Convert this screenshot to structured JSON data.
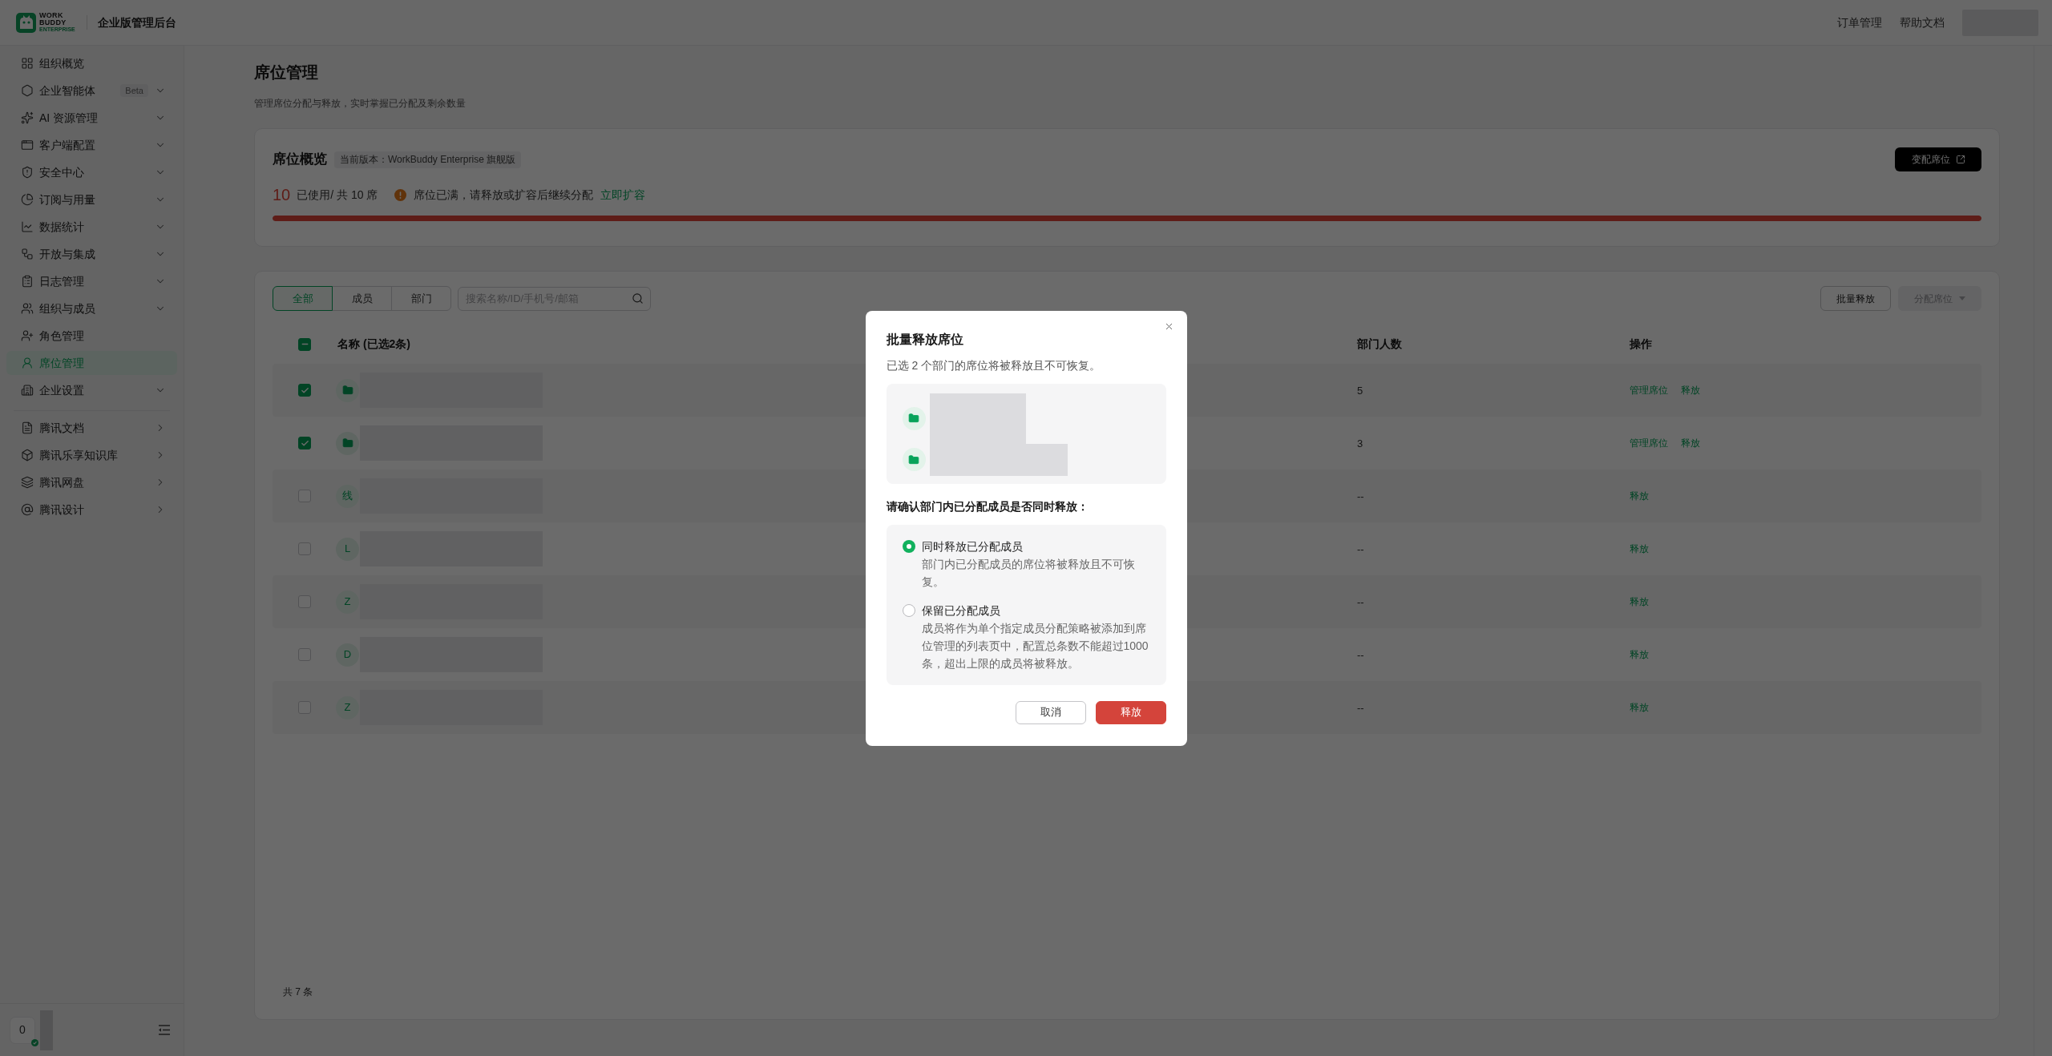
{
  "header": {
    "logo": {
      "lines": [
        "WORK",
        "BUDDY",
        "ENTERPRISE"
      ]
    },
    "title": "企业版管理后台",
    "links": [
      "订单管理",
      "帮助文档"
    ]
  },
  "sidebar": {
    "sections": [
      {
        "items": [
          {
            "label": "组织概览",
            "kind": "page",
            "selected": false
          },
          {
            "label": "企业智能体",
            "badge": "Beta",
            "kind": "group",
            "selected": false
          },
          {
            "label": "AI 资源管理",
            "kind": "group",
            "selected": false
          },
          {
            "label": "客户端配置",
            "kind": "group",
            "selected": false
          },
          {
            "label": "安全中心",
            "kind": "group",
            "selected": false
          },
          {
            "label": "订阅与用量",
            "kind": "group",
            "selected": false
          },
          {
            "label": "数据统计",
            "kind": "group",
            "selected": false
          },
          {
            "label": "开放与集成",
            "kind": "group",
            "selected": false
          },
          {
            "label": "日志管理",
            "kind": "group",
            "selected": false
          },
          {
            "label": "组织与成员",
            "kind": "group",
            "selected": false
          },
          {
            "label": "角色管理",
            "kind": "page",
            "selected": false
          },
          {
            "label": "席位管理",
            "kind": "page",
            "selected": true
          },
          {
            "label": "企业设置",
            "kind": "group",
            "selected": false
          }
        ]
      },
      {
        "items": [
          {
            "label": "腾讯文档",
            "kind": "link",
            "selected": false
          },
          {
            "label": "腾讯乐享知识库",
            "kind": "link",
            "selected": false
          },
          {
            "label": "腾讯网盘",
            "kind": "link",
            "selected": false
          },
          {
            "label": "腾讯设计",
            "kind": "link",
            "selected": false
          }
        ]
      }
    ],
    "user": {
      "avatar_text": "0"
    }
  },
  "page": {
    "title": "席位管理",
    "subtitle": "管理席位分配与释放，实时掌握已分配及剩余数量"
  },
  "overview": {
    "title": "席位概览",
    "version_tag": "当前版本：WorkBuddy Enterprise 旗舰版",
    "action_button": "变配席位",
    "used": "10",
    "usage_text": "已使用/ 共 10 席",
    "warning": "席位已满，请释放或扩容后继续分配",
    "warning_link": "立即扩容",
    "usage_bar": {
      "level": 1
    }
  },
  "seats": {
    "tabs": [
      {
        "label": "全部",
        "selected": true
      },
      {
        "label": "成员",
        "selected": false
      },
      {
        "label": "部门",
        "selected": false
      }
    ],
    "search": {
      "placeholder": "搜索名称/ID/手机号/邮箱"
    },
    "buttons": [
      {
        "label": "批量释放",
        "kind": "outline",
        "disabled": false
      },
      {
        "label": "分配席位",
        "kind": "dropdown",
        "disabled": true
      }
    ],
    "table": {
      "select_all": {
        "indeterminate": true
      },
      "columns": [
        "名称 (已选2条)",
        "部门人数",
        "操作"
      ],
      "rows": [
        {
          "checked": true,
          "avatar": {
            "kind": "folder"
          },
          "count": "5",
          "actions": [
            "管理席位",
            "释放"
          ]
        },
        {
          "checked": true,
          "avatar": {
            "kind": "folder"
          },
          "count": "3",
          "actions": [
            "管理席位",
            "释放"
          ]
        },
        {
          "checked": false,
          "avatar": {
            "kind": "letter",
            "text": "线"
          },
          "count": "--",
          "actions": [
            "释放"
          ]
        },
        {
          "checked": false,
          "avatar": {
            "kind": "letter",
            "text": "L"
          },
          "count": "--",
          "actions": [
            "释放"
          ]
        },
        {
          "checked": false,
          "avatar": {
            "kind": "letter",
            "text": "Z"
          },
          "count": "--",
          "actions": [
            "释放"
          ]
        },
        {
          "checked": false,
          "avatar": {
            "kind": "letter",
            "text": "D"
          },
          "count": "--",
          "actions": [
            "释放"
          ]
        },
        {
          "checked": false,
          "avatar": {
            "kind": "letter",
            "text": "Z"
          },
          "count": "--",
          "actions": [
            "释放"
          ]
        }
      ]
    },
    "total": "共 7 条"
  },
  "dialog": {
    "title": "批量释放席位",
    "description": "已选 2 个部门的席位将被释放且不可恢复。",
    "departments": [
      {
        "kind": "folder"
      },
      {
        "kind": "folder"
      }
    ],
    "question": "请确认部门内已分配成员是否同时释放：",
    "options": [
      {
        "label": "同时释放已分配成员",
        "description": "部门内已分配成员的席位将被释放且不可恢复。",
        "selected": true
      },
      {
        "label": "保留已分配成员",
        "description": "成员将作为单个指定成员分配策略被添加到席位管理的列表页中，配置总条数不能超过1000条，超出上限的成员将被释放。",
        "selected": false
      }
    ],
    "buttons": [
      {
        "label": "取消",
        "kind": "secondary"
      },
      {
        "label": "释放",
        "kind": "danger"
      }
    ]
  }
}
